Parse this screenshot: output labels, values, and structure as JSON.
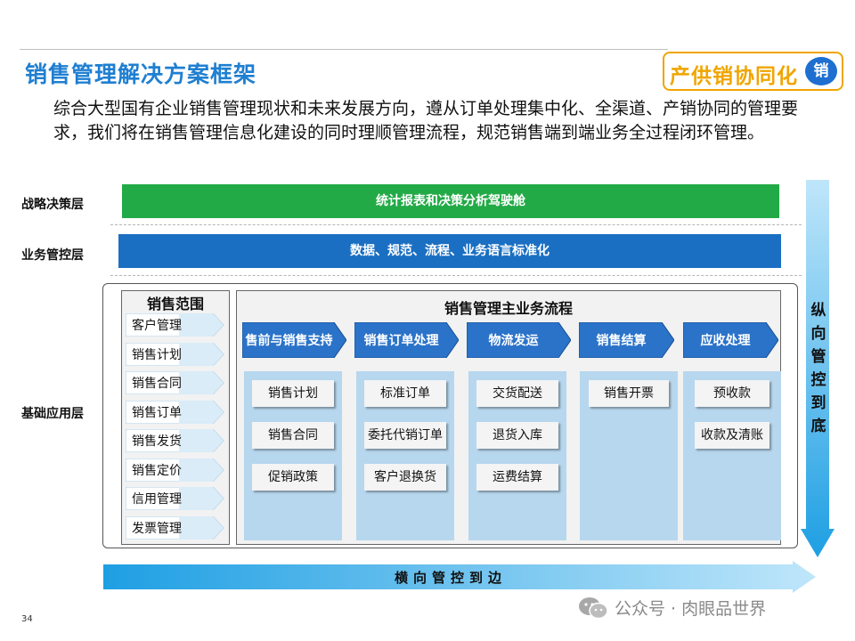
{
  "header": {
    "title": "销售管理解决方案框架",
    "badge_text": "产供销协同化",
    "badge_circle": "销"
  },
  "intro": "综合大型国有企业销售管理现状和未来发展方向，遵从订单处理集中化、全渠道、产销协同的管理要求，我们将在销售管理信息化建设的同时理顺管理流程，规范销售端到端业务全过程闭环管理。",
  "layers": {
    "strategy": {
      "label": "战略决策层",
      "bar": "统计报表和决策分析驾驶舱"
    },
    "business": {
      "label": "业务管控层",
      "bar": "数据、规范、流程、业务语言标准化"
    },
    "base": {
      "label": "基础应用层"
    }
  },
  "scope": {
    "title": "销售范围",
    "items": [
      "客户管理",
      "销售计划",
      "销售合同",
      "销售订单",
      "销售发货",
      "销售定价",
      "信用管理",
      "发票管理"
    ]
  },
  "process": {
    "title": "销售管理主业务流程",
    "stages": [
      {
        "name": "售前与销售支持",
        "items": [
          "销售计划",
          "销售合同",
          "促销政策"
        ]
      },
      {
        "name": "销售订单处理",
        "items": [
          "标准订单",
          "委托代销订单",
          "客户退换货"
        ]
      },
      {
        "name": "物流发运",
        "items": [
          "交货配送",
          "退货入库",
          "运费结算"
        ]
      },
      {
        "name": "销售结算",
        "items": [
          "销售开票"
        ]
      },
      {
        "name": "应收处理",
        "items": [
          "预收款",
          "收款及清账"
        ]
      }
    ]
  },
  "arrows": {
    "vertical": [
      "纵",
      "向",
      "管",
      "控",
      "到",
      "底"
    ],
    "horizontal": "横向管控到边"
  },
  "footer": {
    "page": "34",
    "watermark": "公众号 · 肉眼品世界"
  },
  "colors": {
    "title_blue": "#1f7fd1",
    "badge_orange": "#f0a500",
    "green_bar": "#22aa46",
    "blue_bar": "#1b6fc2",
    "chevron_blue": "#2b73c9",
    "arrow_cyan": "#29a7e6",
    "column_blue": "#b7d7ee"
  }
}
